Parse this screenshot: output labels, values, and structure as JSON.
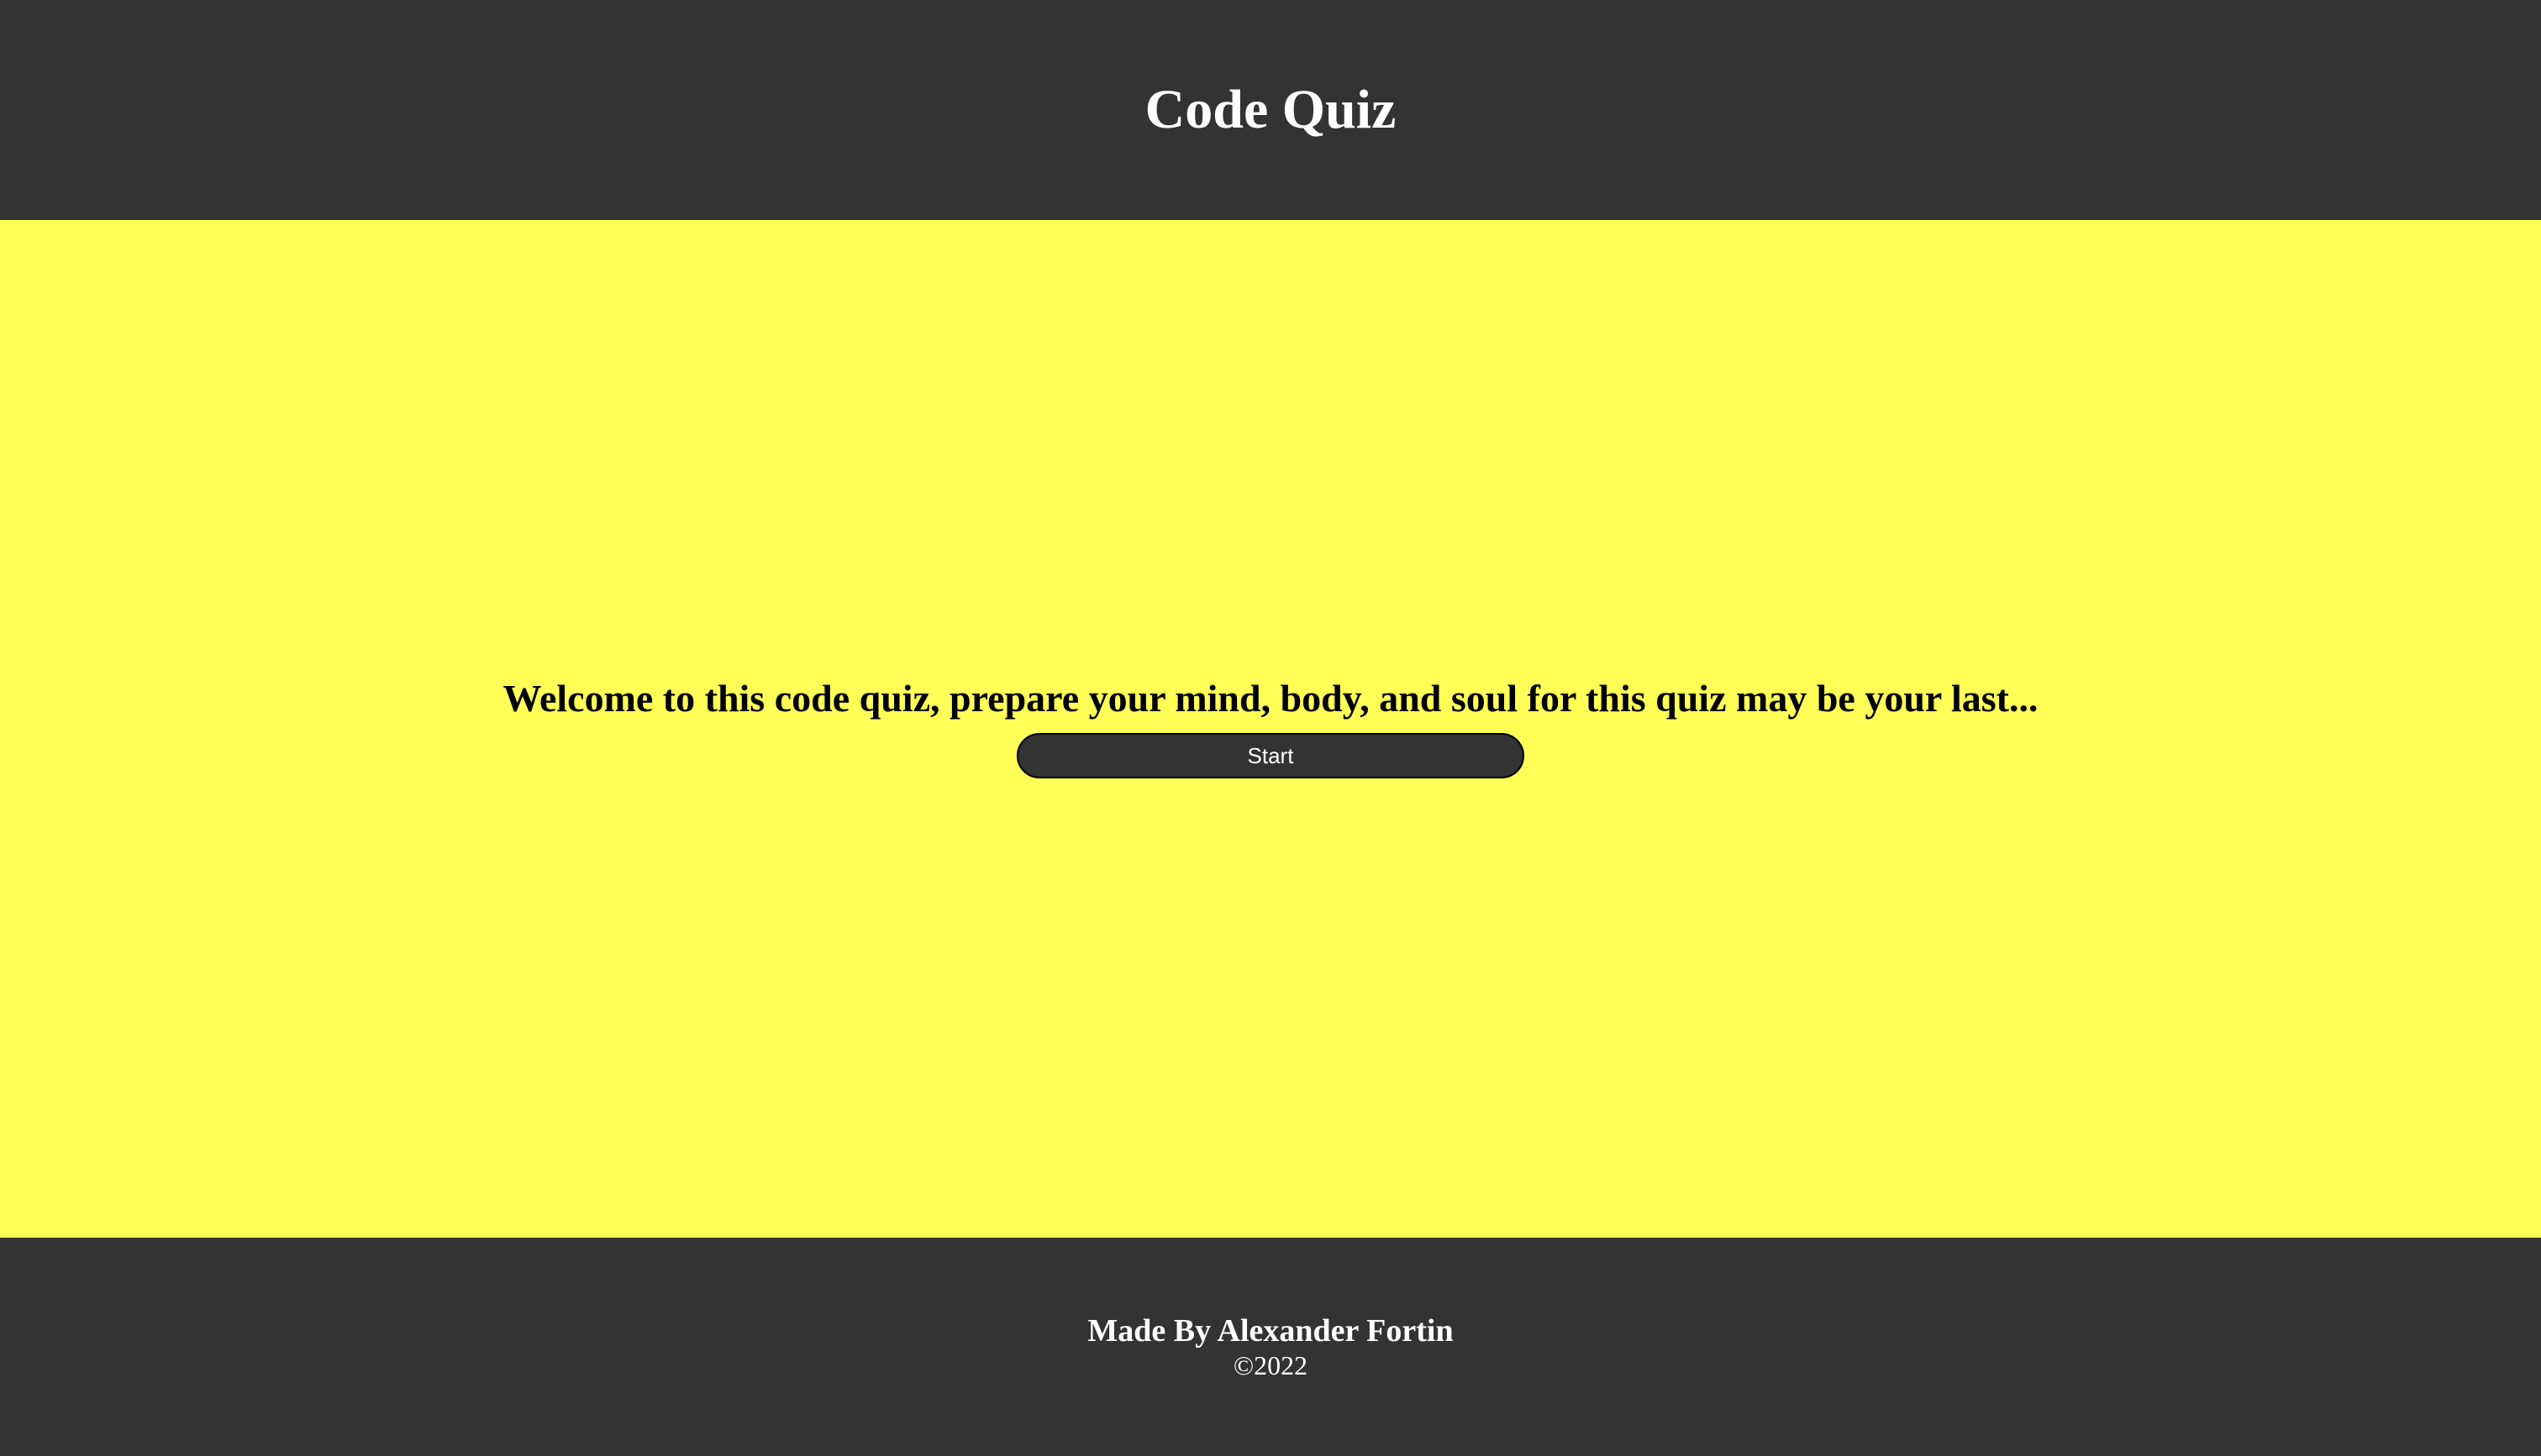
{
  "header": {
    "title": "Code Quiz"
  },
  "main": {
    "welcome": "Welcome to this code quiz, prepare your mind, body, and soul for this quiz may be your last...",
    "start_label": "Start"
  },
  "footer": {
    "author": "Made By Alexander Fortin",
    "copyright": "©2022"
  },
  "colors": {
    "header_bg": "#333333",
    "main_bg": "#ffff57",
    "button_bg": "#333333",
    "text_light": "#ffffff",
    "text_dark": "#000000"
  }
}
